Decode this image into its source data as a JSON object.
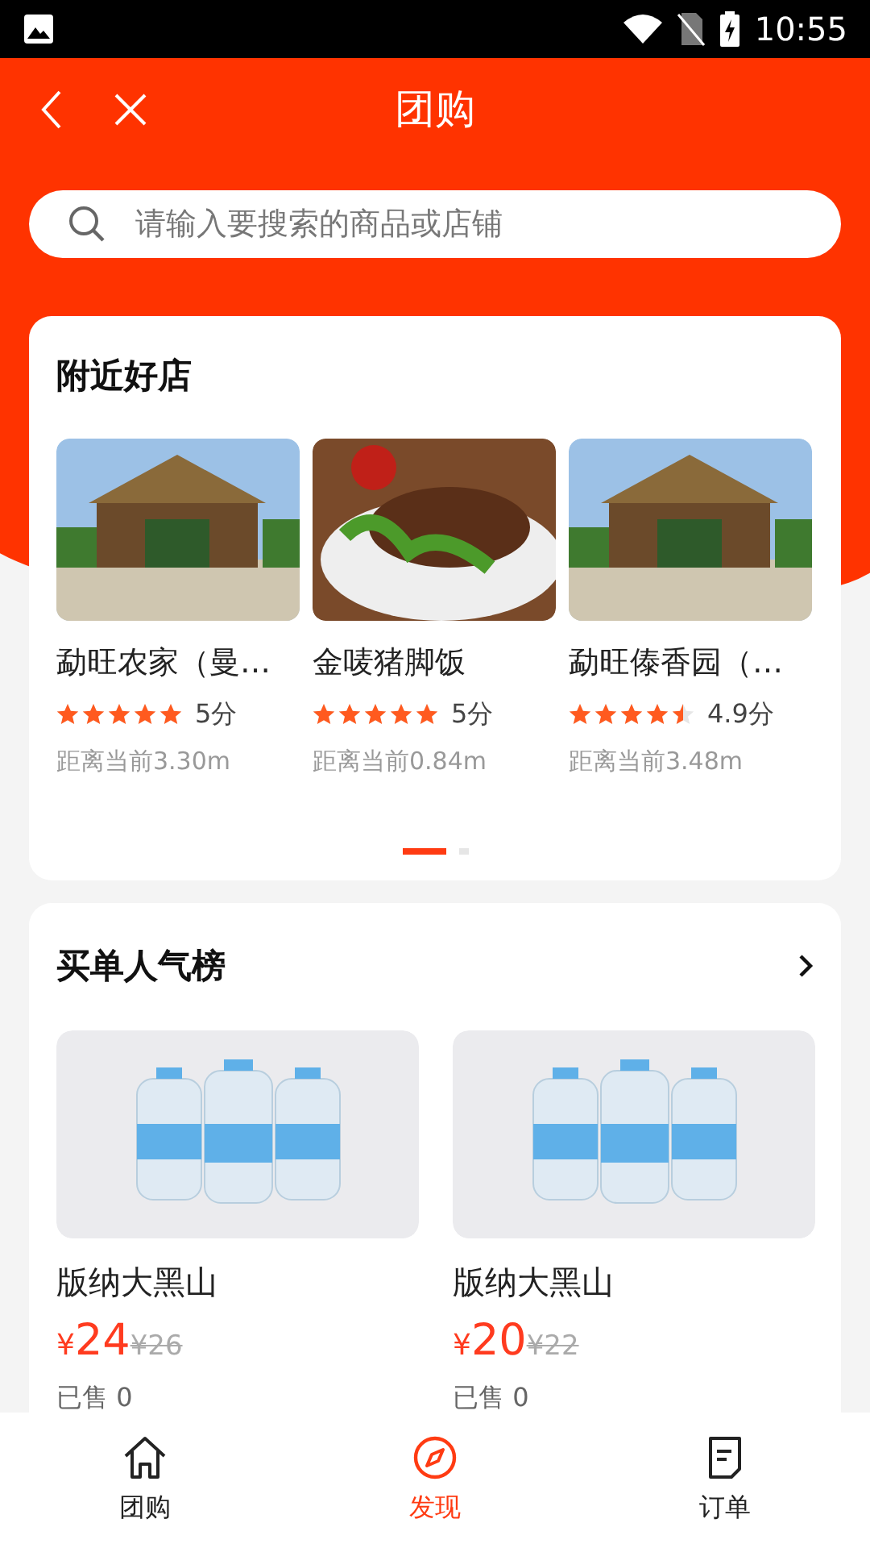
{
  "status_bar": {
    "time": "10:55"
  },
  "header": {
    "title": "团购"
  },
  "search": {
    "placeholder": "请输入要搜索的商品或店铺"
  },
  "nearby": {
    "title": "附近好店",
    "shops": [
      {
        "name": "勐旺农家（曼…",
        "stars": 5,
        "score": "5分",
        "distance": "距离当前3.30m",
        "kind": "gate"
      },
      {
        "name": "金唛猪脚饭",
        "stars": 5,
        "score": "5分",
        "distance": "距离当前0.84m",
        "kind": "food"
      },
      {
        "name": "勐旺傣香园（…",
        "stars": 4.5,
        "score": "4.9分",
        "distance": "距离当前3.48m",
        "kind": "gate"
      }
    ],
    "pages": [
      {
        "selected": true
      },
      {
        "selected": false
      }
    ]
  },
  "ranking": {
    "title": "买单人气榜",
    "products": [
      {
        "name": "版纳大黑山",
        "currency": "¥",
        "price": "24",
        "old_currency": "¥",
        "old_price": "26",
        "sold": "已售 0"
      },
      {
        "name": "版纳大黑山",
        "currency": "¥",
        "price": "20",
        "old_currency": "¥",
        "old_price": "22",
        "sold": "已售 0"
      }
    ]
  },
  "tabbar": [
    {
      "label": "团购",
      "kind": "home",
      "selected": false
    },
    {
      "label": "发现",
      "kind": "compass",
      "selected": true
    },
    {
      "label": "订单",
      "kind": "doc",
      "selected": false
    }
  ]
}
